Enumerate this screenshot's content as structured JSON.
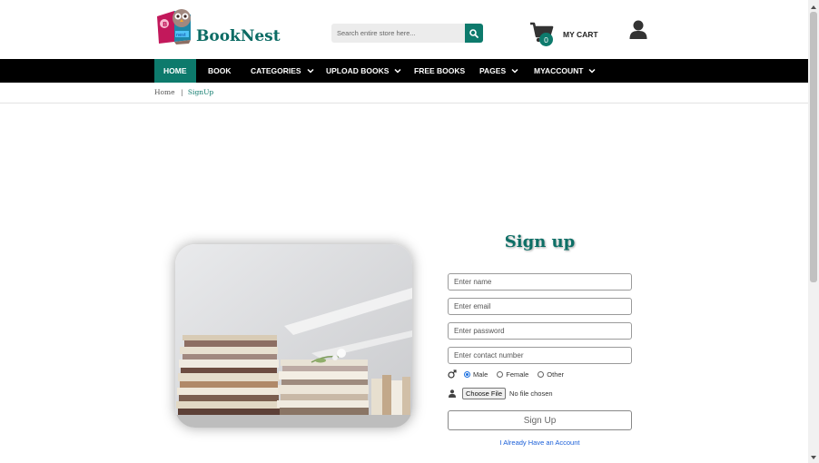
{
  "header": {
    "brand": "BookNest",
    "search_placeholder": "Search entire store here...",
    "cart_count": "0",
    "cart_label": "MY CART"
  },
  "nav": {
    "items": [
      {
        "label": "HOME",
        "dropdown": false,
        "active": true
      },
      {
        "label": "BOOK",
        "dropdown": false
      },
      {
        "label": "CATEGORIES",
        "dropdown": true
      },
      {
        "label": "UPLOAD BOOKS",
        "dropdown": true
      },
      {
        "label": "FREE BOOKS",
        "dropdown": false
      },
      {
        "label": "PAGES",
        "dropdown": true
      },
      {
        "label": "MYACCOUNT",
        "dropdown": true
      }
    ]
  },
  "breadcrumb": {
    "home": "Home",
    "separator": "|",
    "current": "SignUp"
  },
  "form": {
    "title": "Sign up",
    "name_placeholder": "Enter name",
    "email_placeholder": "Enter email",
    "password_placeholder": "Enter password",
    "contact_placeholder": "Enter contact number",
    "gender_options": [
      "Male",
      "Female",
      "Other"
    ],
    "gender_selected": "Male",
    "file_button": "Choose File",
    "file_status": "No file chosen",
    "submit_label": "Sign Up",
    "login_link": "I Already Have an Account"
  },
  "colors": {
    "accent": "#0d7a6c",
    "nav_bg": "#000000",
    "link": "#1a5fd8"
  }
}
